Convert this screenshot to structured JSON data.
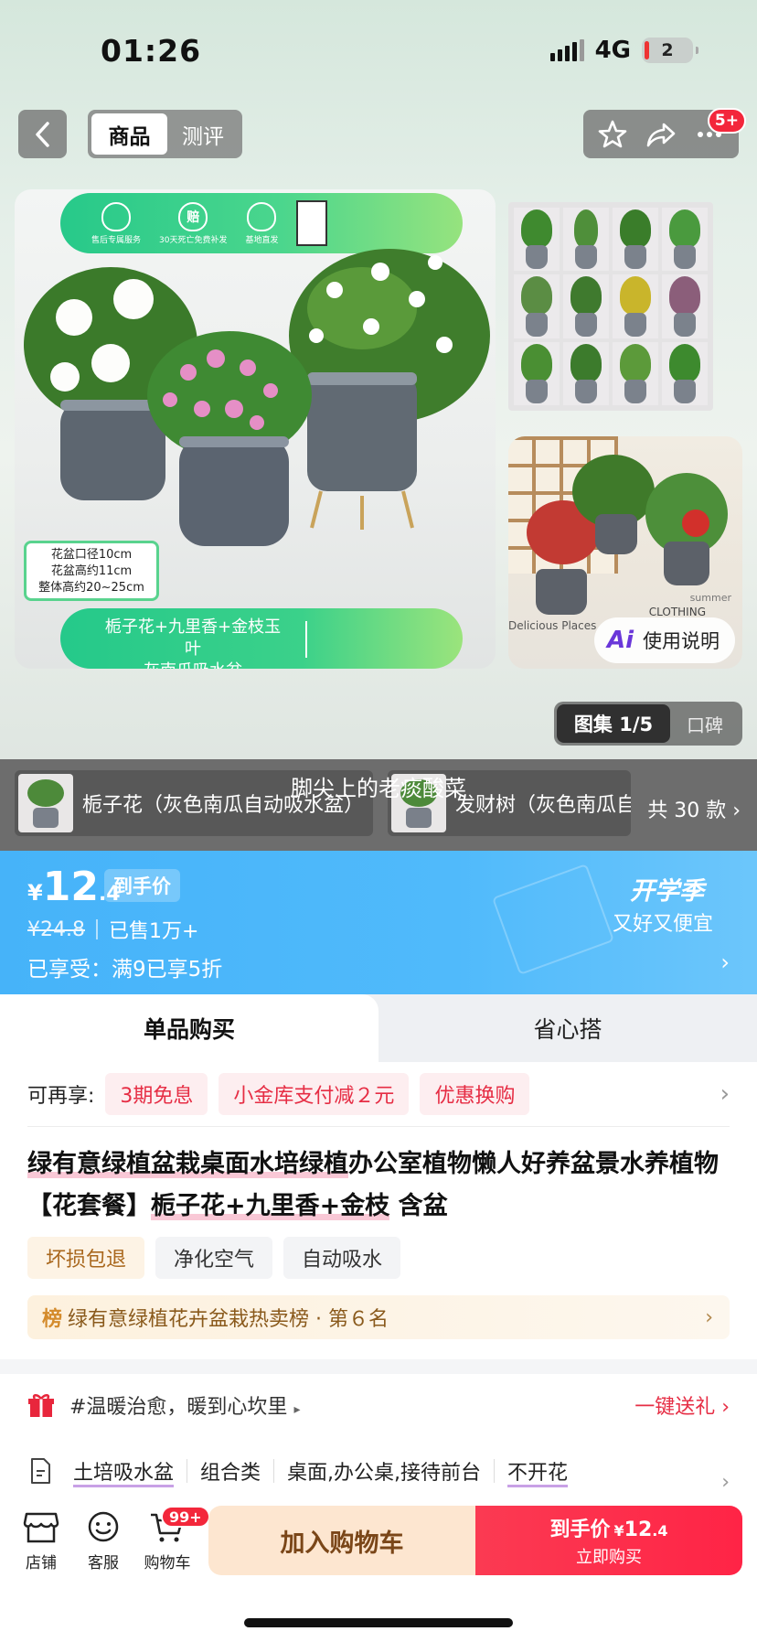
{
  "status_bar": {
    "time": "01:26",
    "network": "4G",
    "battery": "2"
  },
  "header": {
    "tabs": [
      {
        "label": "商品",
        "active": true
      },
      {
        "label": "测评",
        "active": false
      }
    ],
    "menu_badge": "5+",
    "icons": {
      "back": "back-arrow-icon",
      "favorite": "star-icon",
      "share": "share-icon",
      "more": "more-icon"
    }
  },
  "main_image": {
    "services": [
      "售后专属服务",
      "30天死亡免费补发",
      "基地直发"
    ],
    "service_marks": [
      "",
      "赔",
      ""
    ],
    "size_info": [
      "花盆口径10cm",
      "花盆高约11cm",
      "整体高约20~25cm"
    ],
    "combo_lines": [
      "栀子花+九里香+金枝玉叶",
      "灰南瓜吸水盆"
    ]
  },
  "room_image": {
    "usage_button": "使用说明",
    "ai_logo": "Ai",
    "sign_words": [
      "Delicious Places",
      "summer",
      "CLOTHING"
    ]
  },
  "gallery": {
    "active_label": "图集 1/5",
    "inactive_label": "口碑"
  },
  "variants": {
    "items": [
      "栀子花（灰色南瓜自动吸水盆）",
      "发财树（灰色南瓜自"
    ],
    "total": "共 30 款",
    "overlay_text": "脚尖上的老痰酸菜"
  },
  "price": {
    "currency": "¥",
    "integer": "12",
    "decimal": ".4",
    "label": "到手价",
    "original": "¥24.8",
    "sold": "已售1万+",
    "discount": "已享受：满9已享5折",
    "promo_title": "开学季",
    "promo_subtitle": "又好又便宜",
    "colors": {
      "banner": "#4fb8fa"
    }
  },
  "buy_tabs": [
    {
      "label": "单品购买",
      "active": true
    },
    {
      "label": "省心搭",
      "active": false
    }
  ],
  "offers": {
    "label": "可再享:",
    "chips": [
      "3期免息",
      "小金库支付减２元",
      "优惠换购"
    ]
  },
  "product": {
    "title_highlight_1": "绿有意绿植盆栽桌面水培绿植",
    "title_rest_1": "办公室植物懒人好养盆景水养植物 【花套餐】",
    "title_highlight_2": "栀子花+九里香+金枝",
    "title_rest_2": " 含盆",
    "tags": [
      "坏损包退",
      "净化空气",
      "自动吸水"
    ],
    "rank_icon": "榜",
    "rank_text": "绿有意绿植花卉盆栽热卖榜 · 第６名"
  },
  "gift": {
    "text": "#温暖治愈，暖到心坎里",
    "link": "一键送礼"
  },
  "attributes": [
    "土培吸水盆",
    "组合类",
    "桌面,办公桌,接待前台",
    "不开花"
  ],
  "bottom_nav": {
    "shop": "店铺",
    "service": "客服",
    "cart": "购物车",
    "cart_badge": "99+",
    "add_cart": "加入购物车",
    "buy_label": "到手价",
    "buy_currency": "¥",
    "buy_integer": "12",
    "buy_decimal": ".4",
    "buy_sub": "立即购买",
    "colors": {
      "buy": "#fb2f4b",
      "add_cart_bg": "#fde6d0"
    }
  }
}
